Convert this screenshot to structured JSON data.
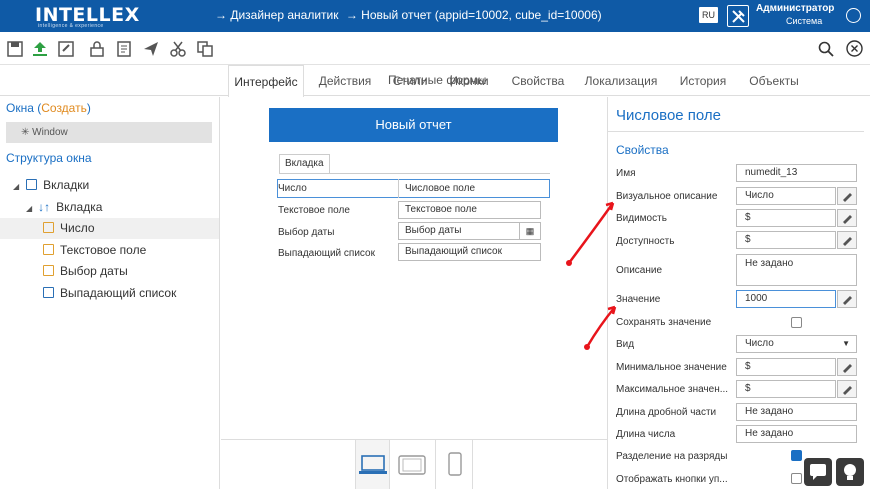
{
  "header": {
    "logo_text": "INTELLEX",
    "logo_tagline": "intelligence & experience",
    "breadcrumb": [
      "→ Дизайнер аналитик",
      "→ Новый отчет (appid=10002, cube_id=10006)"
    ],
    "lang": "RU",
    "user_name": "Администратор",
    "user_role": "Система"
  },
  "toolbar": {
    "icons": [
      "save-icon",
      "upload-icon",
      "save-as-icon",
      "lock-icon",
      "report-icon",
      "send-icon",
      "cut-icon",
      "copy-icon"
    ],
    "tabs": [
      "Интерфейс",
      "Действия",
      "Стили",
      "Иконки",
      "Свойства",
      "Локализация",
      "История",
      "Объекты"
    ],
    "active_tab": "Интерфейс",
    "subtab": "Печатные формы"
  },
  "left": {
    "windows_label": "Окна",
    "create_label": "Создать",
    "window_item": "Window",
    "structure_label": "Структура окна",
    "tree": [
      {
        "label": "Вкладки",
        "level": 0
      },
      {
        "label": "Вкладка",
        "level": 1
      },
      {
        "label": "Число",
        "level": 2,
        "selected": true
      },
      {
        "label": "Текстовое поле",
        "level": 2
      },
      {
        "label": "Выбор даты",
        "level": 2
      },
      {
        "label": "Выпадающий список",
        "level": 2
      }
    ]
  },
  "form": {
    "title": "Новый отчет",
    "tab": "Вкладка",
    "rows": [
      {
        "label": "Число",
        "value": "Числовое поле"
      },
      {
        "label": "Текстовое поле",
        "value": "Текстовое поле"
      },
      {
        "label": "Выбор даты",
        "value": "Выбор даты"
      },
      {
        "label": "Выпадающий список",
        "value": "Выпадающий список"
      }
    ]
  },
  "props": {
    "title": "Числовое поле",
    "section": "Свойства",
    "items": [
      {
        "label": "Имя",
        "value": "numedit_13",
        "edit": false
      },
      {
        "label": "Визуальное описание",
        "value": "Число",
        "edit": true
      },
      {
        "label": "Видимость",
        "value": "$",
        "edit": true
      },
      {
        "label": "Доступность",
        "value": "$",
        "edit": true
      },
      {
        "label": "Описание",
        "value": "Не задано",
        "edit": false
      },
      {
        "label": "Значение",
        "value": "1000",
        "edit": true
      },
      {
        "label": "Сохранять значение",
        "value": "",
        "edit": false
      },
      {
        "label": "Вид",
        "value": "Число",
        "edit": false
      },
      {
        "label": "Минимальное значение",
        "value": "$",
        "edit": true
      },
      {
        "label": "Максимальное значен...",
        "value": "$",
        "edit": true
      },
      {
        "label": "Длина дробной части",
        "value": "Не задано",
        "edit": false
      },
      {
        "label": "Длина числа",
        "value": "Не задано",
        "edit": false
      },
      {
        "label": "Разделение на разряды",
        "value": "",
        "edit": false
      },
      {
        "label": "Отображать кнопки уп...",
        "value": "",
        "edit": false
      }
    ]
  },
  "colors": {
    "accent": "#1a6fc4",
    "header": "#0f5aa6",
    "annotation": "#e8141b"
  }
}
